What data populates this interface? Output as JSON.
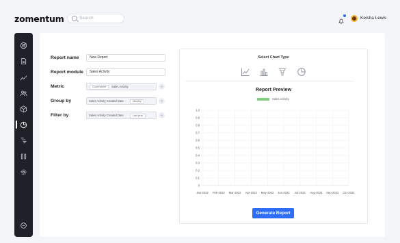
{
  "header": {
    "logo": "zomentum",
    "search_placeholder": "Search",
    "user_name": "Keisha Lewis"
  },
  "sidebar": {
    "items": [
      {
        "icon": "target-icon"
      },
      {
        "icon": "document-icon"
      },
      {
        "icon": "trend-icon"
      },
      {
        "icon": "users-icon"
      },
      {
        "icon": "box-icon"
      },
      {
        "icon": "pie-chart-icon",
        "active": true
      },
      {
        "icon": "workflow-icon"
      },
      {
        "icon": "integrations-icon"
      },
      {
        "icon": "settings-icon"
      },
      {
        "icon": "chat-icon"
      }
    ]
  },
  "form": {
    "report_name_label": "Report name",
    "report_name_value": "New Report",
    "report_module_label": "Report module",
    "report_module_value": "Sales Activity",
    "metric_label": "Metric",
    "metric_chip": "Count where",
    "metric_value": "Sales Activity",
    "group_by_label": "Group by",
    "group_by_value": "Sales Activity Created Date",
    "group_by_chip": "Monthly",
    "filter_by_label": "Filter by",
    "filter_by_value": "Sales Activity Created Date",
    "filter_by_chip": "Last year",
    "plus": "+"
  },
  "panel": {
    "select_chart_type": "Select Chart Type",
    "chart_types": [
      "line-chart-icon",
      "bar-chart-icon",
      "funnel-chart-icon",
      "pie-chart-icon"
    ],
    "preview_title": "Report  Preview",
    "generate_button": "Generate Report"
  },
  "colors": {
    "accent": "#2f6df6",
    "series": "#7fd17f",
    "sidebar": "#1f2128"
  },
  "chart_data": {
    "type": "line",
    "series": [
      {
        "name": "Sales Activity",
        "values": []
      }
    ],
    "categories": [
      "Jan-2022",
      "Feb-2022",
      "Mar-2022",
      "Apr-2022",
      "May-2022",
      "Jun-2022",
      "Jul-2022",
      "Aug-2022",
      "Sep-2022",
      "Oct-2022"
    ],
    "y_ticks": [
      "0",
      "0.1",
      "0.2",
      "0.3",
      "0.4",
      "0.5",
      "0.6",
      "0.7",
      "0.8",
      "0.9",
      "1.0"
    ],
    "ylim": [
      0,
      1
    ],
    "grid": true,
    "legend": "top-center"
  }
}
